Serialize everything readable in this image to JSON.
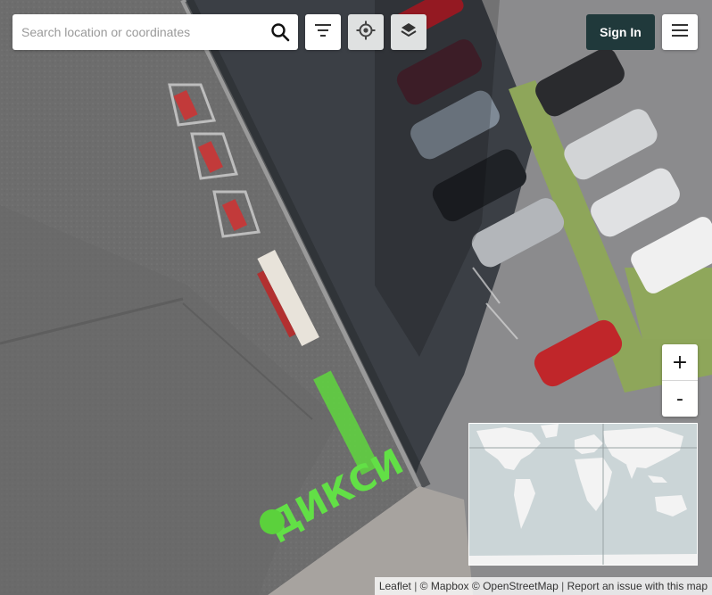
{
  "search": {
    "placeholder": "Search location or coordinates",
    "value": ""
  },
  "toolbar": {
    "search_icon": "search-icon",
    "filter_icon": "filter-icon",
    "locate_icon": "locate-icon",
    "layers_icon": "layers-icon"
  },
  "account": {
    "signin_label": "Sign In",
    "menu_icon": "hamburger-menu-icon"
  },
  "zoom": {
    "in_label": "+",
    "out_label": "-"
  },
  "rooftop_sign": {
    "text": "ДИКСИ"
  },
  "attribution": {
    "leaflet": "Leaflet",
    "sep1": "|",
    "mapbox": "© Mapbox",
    "osm": "© OpenStreetMap",
    "sep2": "|",
    "report": "Report an issue with this map"
  },
  "colors": {
    "signin_bg": "#20393b",
    "grey_button": "#dfe1e1",
    "roof": "#6f6f6f",
    "asphalt": "#3a3e44",
    "grass": "#8aa556",
    "sign_green": "#6ee04a",
    "minimap_water": "#cbd5d7",
    "minimap_land": "#f2f2f2"
  }
}
